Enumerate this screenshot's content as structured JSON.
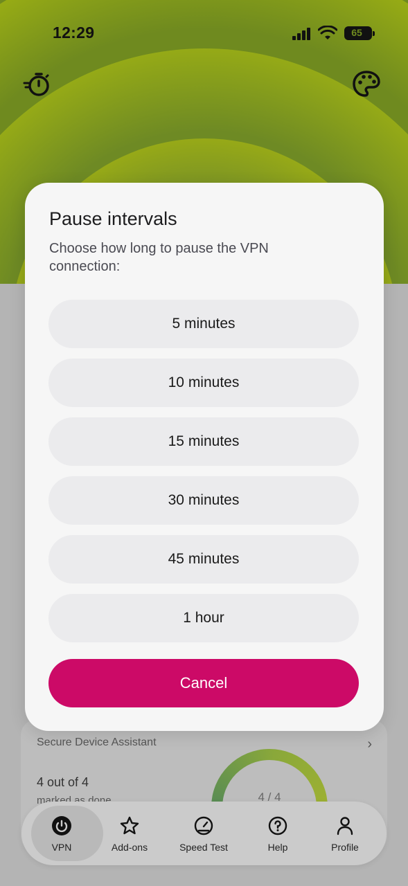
{
  "status_bar": {
    "time": "12:29",
    "battery": "65"
  },
  "top_icons": {
    "left": "timer-icon",
    "right": "palette-icon"
  },
  "modal": {
    "title": "Pause intervals",
    "description": "Choose how long to pause the VPN connection:",
    "options": [
      "5 minutes",
      "10 minutes",
      "15 minutes",
      "30 minutes",
      "45 minutes",
      "1 hour"
    ],
    "cancel_label": "Cancel",
    "cancel_color": "#cc0a67"
  },
  "assistant_card": {
    "title": "Secure Device Assistant",
    "count": "4 out of 4",
    "subtitle": "marked as done",
    "gauge_label": "4 / 4"
  },
  "nav": {
    "items": [
      {
        "label": "VPN",
        "icon": "power-icon",
        "active": true
      },
      {
        "label": "Add-ons",
        "icon": "star-icon",
        "active": false
      },
      {
        "label": "Speed Test",
        "icon": "speedometer-icon",
        "active": false
      },
      {
        "label": "Help",
        "icon": "help-icon",
        "active": false
      },
      {
        "label": "Profile",
        "icon": "profile-icon",
        "active": false
      }
    ]
  },
  "colors": {
    "hero_green": "#6f8a1f",
    "accent_pink": "#cc0a67"
  }
}
